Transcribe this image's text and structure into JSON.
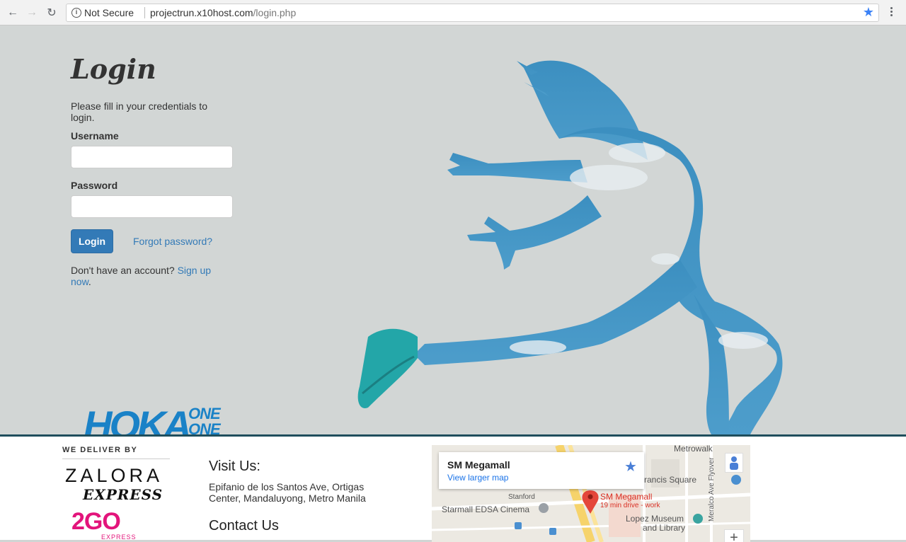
{
  "browser": {
    "security_label": "Not Secure",
    "url_host": "projectrun.x10host.com",
    "url_path": "/login.php"
  },
  "login": {
    "title": "Login",
    "helper_text": "Please fill in your credentials to login.",
    "username_label": "Username",
    "username_value": "",
    "password_label": "Password",
    "password_value": "",
    "login_button": "Login",
    "forgot_link": "Forgot password?",
    "signup_prefix": "Don't have an account?",
    "signup_link": "Sign up now",
    "signup_suffix": "."
  },
  "brand": {
    "hoka_logo_text": "HOKA ONE ONE",
    "accent_color": "#337ab7",
    "hoka_color": "#1a82c7"
  },
  "footer": {
    "deliver_label": "WE DELIVER BY",
    "partner1_name": "ZALORA",
    "partner1_sub": "EXPRESS",
    "partner2_name": "2GO",
    "partner2_sub": "EXPRESS",
    "visit_title": "Visit Us:",
    "address": "Epifanio de los Santos Ave, Ortigas Center, Mandaluyong, Metro Manila",
    "contact_title": "Contact Us"
  },
  "map": {
    "place_name": "SM Megamall",
    "larger_map_link": "View larger map",
    "pin_label": "SM Megamall",
    "drive_time": "19 min drive - work",
    "labels": {
      "metrowalk": "Metrowalk",
      "francis": "rancis Square",
      "stanford": "Stanford",
      "starmall": "Starmall EDSA Cinema",
      "lopez": "Lopez Museum",
      "library": "and Library",
      "meralco": "Meralco Ave Flyover",
      "zoom_in": "+"
    }
  }
}
